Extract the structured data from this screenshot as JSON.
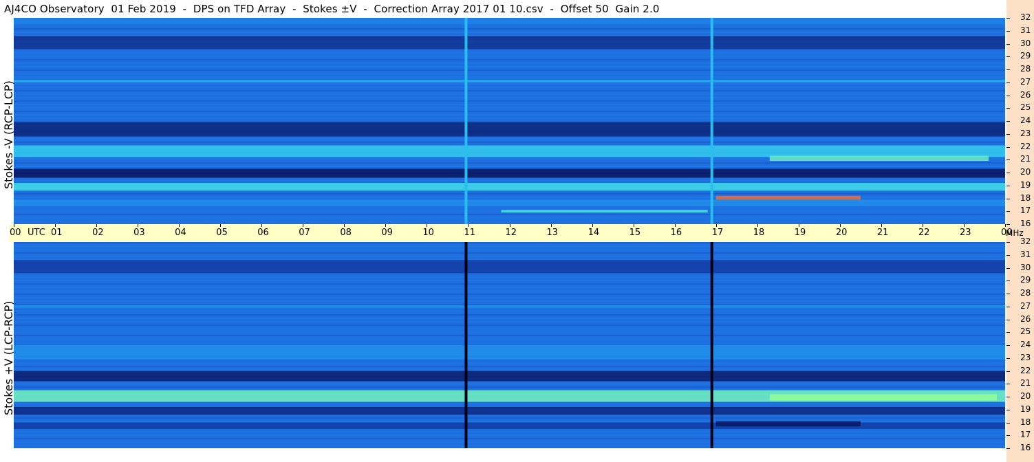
{
  "title": "AJ4CO Observatory  01 Feb 2019  -  DPS on TFD Array  -  Stokes ±V  -  Correction Array 2017 01 10.csv  -  Offset 50  Gain 2.0",
  "colors": {
    "time_axis_bg": "#ffffc6",
    "freq_axis_bg": "#fde0c6",
    "spectrogram_base": "#1d6fe0",
    "spectrogram_dark": "#0b1f6e",
    "spectrogram_bright": "#34e0f0",
    "emission_hot": "#ff6a2a"
  },
  "chart_data": [
    {
      "type": "heatmap",
      "panel": "top",
      "ylabel": "Stokes -V (RCP-LCP)",
      "xlabel": "UTC",
      "x_ticks": [
        "00",
        "01",
        "02",
        "03",
        "04",
        "05",
        "06",
        "07",
        "08",
        "09",
        "10",
        "11",
        "12",
        "13",
        "14",
        "15",
        "16",
        "17",
        "18",
        "19",
        "20",
        "21",
        "22",
        "23",
        "00"
      ],
      "y_unit": "MHz",
      "y_ticks": [
        16,
        17,
        18,
        19,
        20,
        21,
        22,
        23,
        24,
        25,
        26,
        27,
        28,
        29,
        30,
        31,
        32
      ],
      "ylim": [
        16,
        32
      ],
      "xlim": [
        0,
        24
      ],
      "bands": [
        {
          "f0": 31.5,
          "f1": 32,
          "level": 0.55
        },
        {
          "f0": 29.6,
          "f1": 30.6,
          "level": 0.15
        },
        {
          "f0": 27.0,
          "f1": 27.2,
          "level": 0.7
        },
        {
          "f0": 22.8,
          "f1": 23.9,
          "level": 0.08
        },
        {
          "f0": 21.2,
          "f1": 22.1,
          "level": 0.8
        },
        {
          "f0": 19.6,
          "f1": 20.3,
          "level": 0.0
        },
        {
          "f0": 18.6,
          "f1": 19.2,
          "level": 0.85
        },
        {
          "f0": 17.4,
          "f1": 17.9,
          "level": 0.6
        }
      ],
      "vertical_lines": [
        {
          "time": 10.95,
          "level": 0.75
        },
        {
          "time": 16.9,
          "level": 0.75
        }
      ],
      "hot_spots": [
        {
          "t0": 17.0,
          "t1": 20.5,
          "f0": 17.9,
          "f1": 18.2,
          "level": 1.0
        },
        {
          "t0": 11.8,
          "t1": 16.8,
          "f0": 16.9,
          "f1": 17.1,
          "level": 0.9
        },
        {
          "t0": 18.3,
          "t1": 23.6,
          "f0": 20.9,
          "f1": 21.3,
          "level": 0.95
        }
      ]
    },
    {
      "type": "heatmap",
      "panel": "bottom",
      "ylabel": "Stokes +V (LCP-RCP)",
      "xlabel": "UTC",
      "x_ticks": [
        "00",
        "01",
        "02",
        "03",
        "04",
        "05",
        "06",
        "07",
        "08",
        "09",
        "10",
        "11",
        "12",
        "13",
        "14",
        "15",
        "16",
        "17",
        "18",
        "19",
        "20",
        "21",
        "22",
        "23",
        "00"
      ],
      "y_unit": "MHz",
      "y_ticks": [
        16,
        17,
        18,
        19,
        20,
        21,
        22,
        23,
        24,
        25,
        26,
        27,
        28,
        29,
        30,
        31,
        32
      ],
      "ylim": [
        16,
        32
      ],
      "xlim": [
        0,
        24
      ],
      "bands": [
        {
          "f0": 29.6,
          "f1": 30.6,
          "level": 0.2
        },
        {
          "f0": 26.9,
          "f1": 27.1,
          "level": 0.6
        },
        {
          "f0": 22.9,
          "f1": 24.0,
          "level": 0.6
        },
        {
          "f0": 21.2,
          "f1": 22.0,
          "level": 0.05
        },
        {
          "f0": 19.6,
          "f1": 20.5,
          "level": 0.95
        },
        {
          "f0": 18.6,
          "f1": 19.2,
          "level": 0.1
        },
        {
          "f0": 17.5,
          "f1": 18.0,
          "level": 0.2
        }
      ],
      "vertical_lines": [
        {
          "time": 10.95,
          "level": -0.2
        },
        {
          "time": 16.9,
          "level": -0.2
        }
      ],
      "hot_spots": [
        {
          "t0": 17.0,
          "t1": 20.5,
          "f0": 17.7,
          "f1": 18.1,
          "level": 0.0
        },
        {
          "t0": 18.3,
          "t1": 23.8,
          "f0": 19.7,
          "f1": 20.2,
          "level": 1.0
        }
      ]
    }
  ],
  "axis": {
    "utc_label": "UTC",
    "mhz_label": "MHz"
  }
}
